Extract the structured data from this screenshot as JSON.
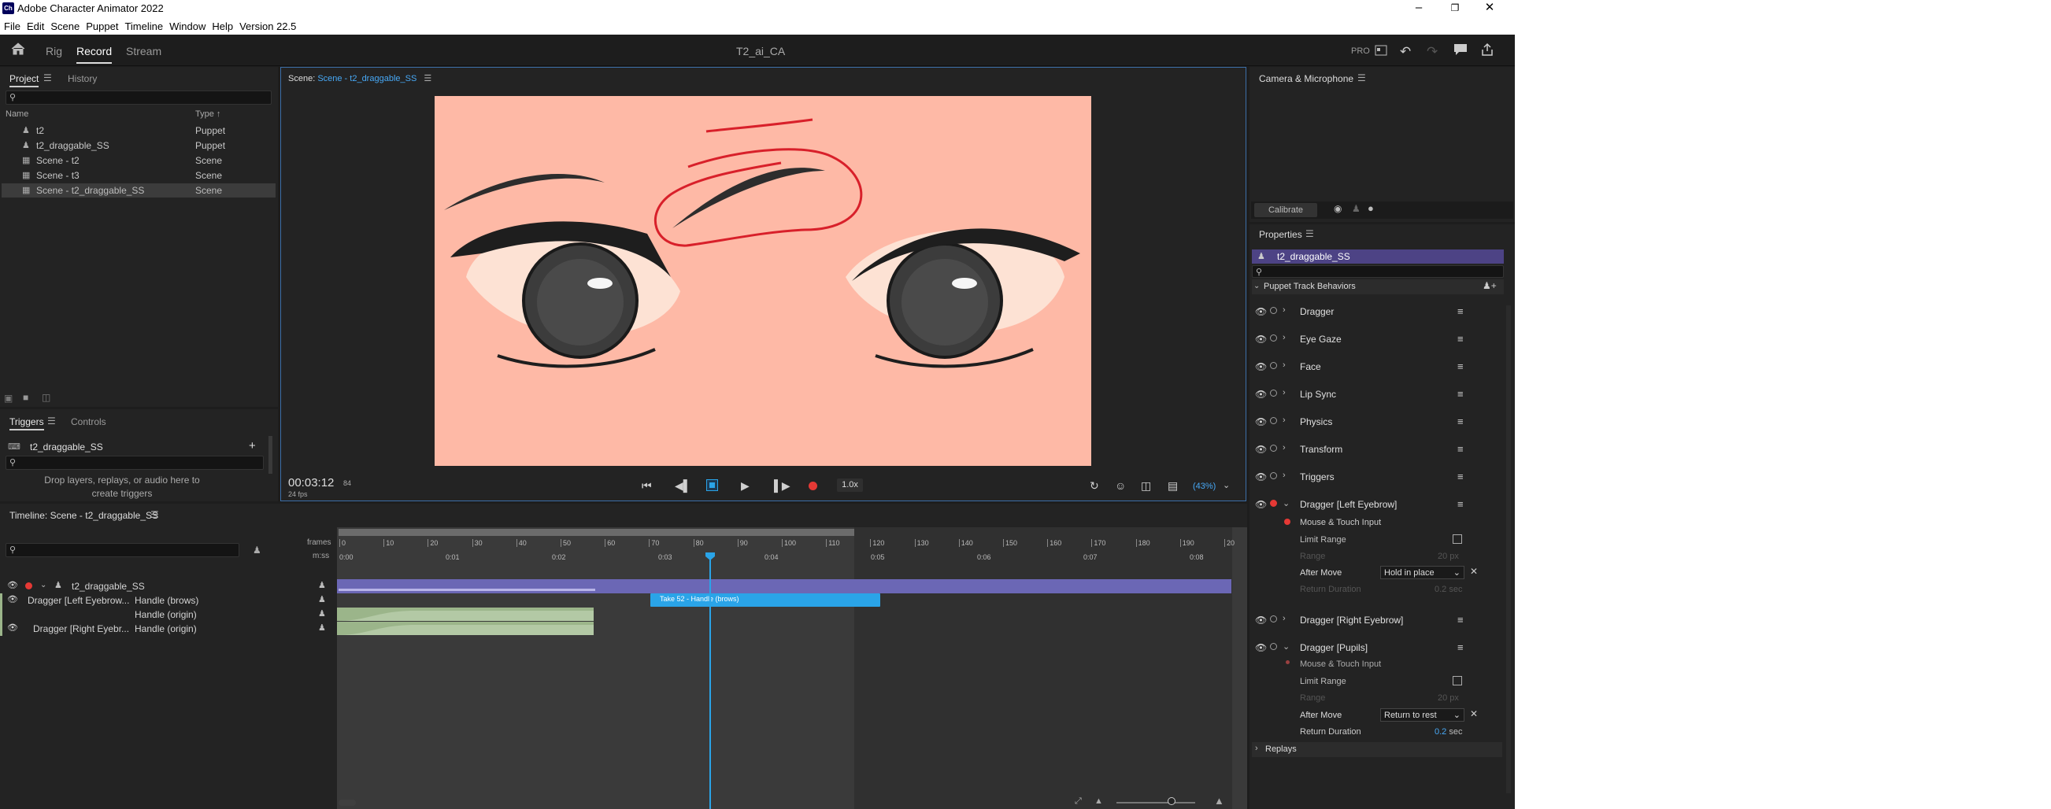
{
  "titlebar": {
    "app_title": "Adobe Character Animator 2022",
    "app_icon": "Ch"
  },
  "menubar": {
    "items": [
      "File",
      "Edit",
      "Scene",
      "Puppet",
      "Timeline",
      "Window",
      "Help",
      "Version 22.5"
    ]
  },
  "workspace": {
    "tabs": [
      {
        "label": "Rig"
      },
      {
        "label": "Record",
        "active": true
      },
      {
        "label": "Stream"
      }
    ],
    "doc_title": "T2_ai_CA",
    "pro_label": "PRO"
  },
  "project": {
    "tabs": [
      "Project",
      "History"
    ],
    "col_name": "Name",
    "col_type": "Type",
    "items": [
      {
        "name": "t2",
        "type": "Puppet",
        "icon": "puppet-icon"
      },
      {
        "name": "t2_draggable_SS",
        "type": "Puppet",
        "icon": "puppet-icon"
      },
      {
        "name": "Scene - t2",
        "type": "Scene",
        "icon": "scene-icon"
      },
      {
        "name": "Scene - t3",
        "type": "Scene",
        "icon": "scene-icon"
      },
      {
        "name": "Scene - t2_draggable_SS",
        "type": "Scene",
        "icon": "scene-icon",
        "selected": true
      }
    ]
  },
  "triggers": {
    "tabs": [
      "Triggers",
      "Controls"
    ],
    "puppet": "t2_draggable_SS",
    "drop_hint_1": "Drop layers, replays, or audio here to",
    "drop_hint_2": "create triggers"
  },
  "scene": {
    "label": "Scene:",
    "name": "Scene - t2_draggable_SS",
    "timecode": "00:03:12",
    "frame": "84",
    "fps": "24 fps",
    "speed": "1.0x",
    "zoom": "(43%)"
  },
  "camera": {
    "title": "Camera & Microphone",
    "calibrate": "Calibrate"
  },
  "properties": {
    "title": "Properties",
    "puppet": "t2_draggable_SS",
    "section": "Puppet Track Behaviors",
    "behaviors": [
      {
        "name": "Dragger",
        "armed": false
      },
      {
        "name": "Eye Gaze",
        "armed": false
      },
      {
        "name": "Face",
        "armed": false
      },
      {
        "name": "Lip Sync",
        "armed": false
      },
      {
        "name": "Physics",
        "armed": false
      },
      {
        "name": "Transform",
        "armed": false
      },
      {
        "name": "Triggers",
        "armed": false
      },
      {
        "name": "Dragger [Left Eyebrow]",
        "armed": true,
        "expanded": true
      },
      {
        "name": "Dragger [Right Eyebrow]",
        "armed": false
      },
      {
        "name": "Dragger [Pupils]",
        "armed": false,
        "expanded": true
      }
    ],
    "left_eyebrow": {
      "input": "Mouse & Touch Input",
      "limit_range": "Limit Range",
      "range": "Range",
      "range_value": "20 px",
      "after_move": "After Move",
      "after_move_value": "Hold in place",
      "return_duration": "Return Duration",
      "return_duration_value": "0.2 sec"
    },
    "pupils": {
      "input": "Mouse & Touch Input",
      "limit_range": "Limit Range",
      "range": "Range",
      "range_value": "20 px",
      "after_move": "After Move",
      "after_move_value": "Return to rest",
      "return_duration": "Return Duration",
      "return_duration_value": "0.2",
      "return_duration_unit": "sec"
    },
    "replays": "Replays"
  },
  "timeline": {
    "title": "Timeline: Scene - t2_draggable_SS",
    "frames_label": "frames",
    "mss_label": "m:ss",
    "frame_ticks": [
      "0",
      "10",
      "20",
      "30",
      "40",
      "50",
      "60",
      "70",
      "80",
      "90",
      "100",
      "110",
      "120",
      "130",
      "140",
      "150",
      "160",
      "170",
      "180",
      "190",
      "20"
    ],
    "time_ticks": [
      "0:00",
      "0:01",
      "0:02",
      "0:03",
      "0:04",
      "0:05",
      "0:06",
      "0:07",
      "0:08"
    ],
    "puppet_track": "t2_draggable_SS",
    "tracks": [
      {
        "behavior": "Dragger [Left Eyebrow...",
        "handle": "Handle (brows)"
      },
      {
        "behavior": "",
        "handle": "Handle (origin)"
      },
      {
        "behavior": "Dragger [Right Eyebr...",
        "handle": "Handle (origin)"
      }
    ],
    "take_label": "Take 52 - Handle (brows)"
  },
  "colors": {
    "accent_blue": "#2aa4e8",
    "record_red": "#e53935",
    "puppet_bar": "#6b67b5",
    "take_green": "#9bb58a",
    "canvas_bg": "#feb9a6"
  }
}
